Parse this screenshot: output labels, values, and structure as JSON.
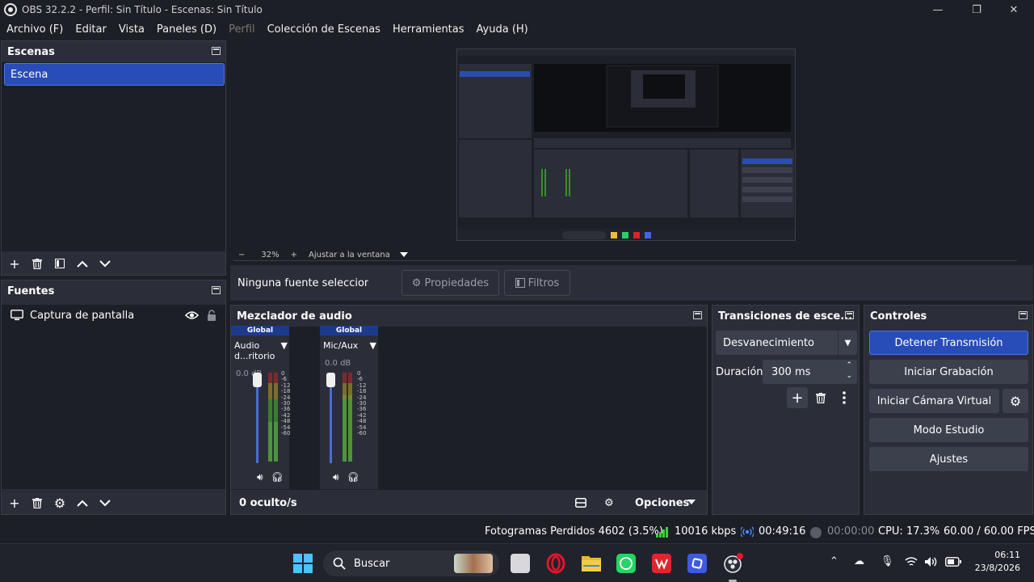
{
  "window": {
    "title": "OBS 32.2.2 - Perfil: Sin Título - Escenas: Sin Título",
    "minimize_glyph": "—",
    "maximize_glyph": "❐",
    "close_glyph": "✕"
  },
  "menu": [
    "Archivo (F)",
    "Editar",
    "Vista",
    "Paneles (D)",
    "Perfil",
    "Colección de Escenas",
    "Herramientas",
    "Ayuda (H)"
  ],
  "scenes": {
    "title": "Escenas",
    "items": [
      "Escena"
    ]
  },
  "sources": {
    "title": "Fuentes",
    "items": [
      "Captura de pantalla"
    ]
  },
  "zoom": {
    "minus": "−",
    "level": "32%",
    "plus": "+",
    "fit_label": "Ajustar a la ventana"
  },
  "context_bar": {
    "no_source": "Ninguna fuente seleccionad",
    "properties": "Propiedades",
    "filters": "Filtros"
  },
  "mixer": {
    "title": "Mezclador de audio",
    "channels": [
      {
        "tag": "Global",
        "name": "Audio d...ritorio",
        "db": "0.0 dB",
        "level": 0.45
      },
      {
        "tag": "Global",
        "name": "Mic/Aux",
        "db": "0.0 dB",
        "level": 0.75
      }
    ],
    "ticks": [
      "0",
      "-6",
      "-12",
      "-18",
      "-24",
      "-30",
      "-36",
      "-42",
      "-48",
      "-54",
      "-60"
    ],
    "hidden_label": "0 oculto/s",
    "options_label": "Opciones"
  },
  "transitions": {
    "title": "Transiciones de esce...",
    "selected": "Desvanecimiento",
    "duration_label": "Duración",
    "duration_value": "300 ms"
  },
  "controls": {
    "title": "Controles",
    "stop_stream": "Detener Transmisión",
    "start_recording": "Iniciar Grabación",
    "start_virtual_cam": "Iniciar Cámara Virtual",
    "studio_mode": "Modo Estudio",
    "settings": "Ajustes"
  },
  "status": {
    "dropped_frames": "Fotogramas Perdidos 4602 (3.5%)",
    "bitrate": "10016 kbps",
    "stream_time": "00:49:16",
    "record_time": "00:00:00",
    "cpu": "CPU: 17.3%",
    "fps": "60.00 / 60.00 FPS"
  },
  "taskbar": {
    "search_placeholder": "Buscar",
    "time": "06:11",
    "date": "23/8/2026"
  },
  "colors": {
    "accent": "#284cb8",
    "panel": "#2b2e38",
    "background": "#1d1f26",
    "meter_green": "#3c8c2c",
    "meter_yellow": "#8c7a22",
    "meter_red": "#8c2a2a"
  }
}
